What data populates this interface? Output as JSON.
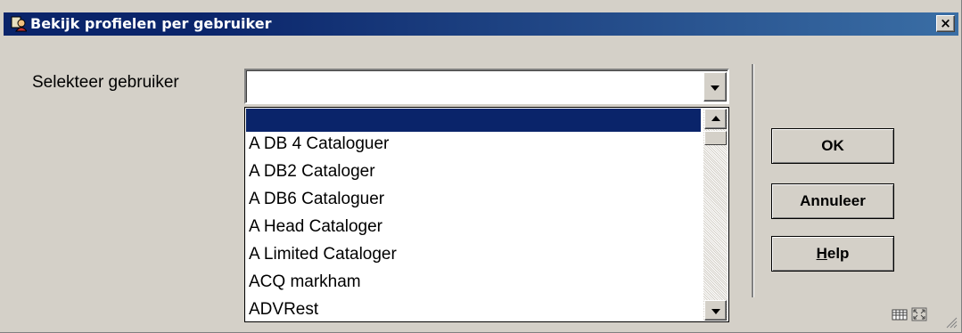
{
  "window": {
    "title": "Bekijk profielen per gebruiker",
    "close_label": "×"
  },
  "form": {
    "user_label": "Selekteer gebruiker",
    "user_value": ""
  },
  "dropdown": {
    "items": [
      "",
      "A DB 4  Cataloguer",
      "A DB2 Cataloger",
      "A DB6 Cataloguer",
      "A Head Cataloger",
      "A Limited Cataloger",
      "ACQ markham",
      "ADVRest"
    ],
    "selected_index": 0
  },
  "buttons": {
    "ok": "OK",
    "cancel": "Annuleer",
    "help_first": "H",
    "help_rest": "elp"
  },
  "icons": {
    "title": "user-profile-icon",
    "status_left": "keyboard-icon",
    "status_right": "resize-window-icon"
  },
  "colors": {
    "title_bar": "#0a246a",
    "selection": "#0a246a",
    "face": "#d4d0c8"
  }
}
